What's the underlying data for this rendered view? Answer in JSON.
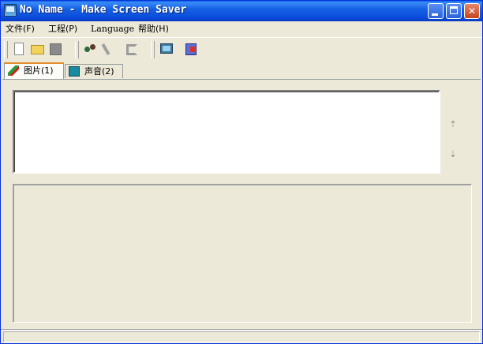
{
  "window": {
    "title": "No Name - Make Screen Saver",
    "min_glyph": "",
    "close_glyph": "✕"
  },
  "menu": {
    "file": "文件(F)",
    "project": "工程(P)",
    "language": "Language",
    "help": "帮助(H)"
  },
  "toolbar": {
    "icons": [
      "new-file-icon",
      "open-folder-icon",
      "save-icon",
      "people-icon",
      "wand-icon",
      "tool-icon",
      "monitor-icon",
      "export-icon"
    ]
  },
  "tabs": [
    {
      "label": "图片(1)",
      "active": true
    },
    {
      "label": "声音(2)",
      "active": false
    }
  ],
  "side_buttons": {
    "up": "⇡",
    "down": "⇣"
  },
  "colors": {
    "titlebar": "#0a48d8",
    "face": "#ece9d8",
    "close": "#c4451e"
  }
}
